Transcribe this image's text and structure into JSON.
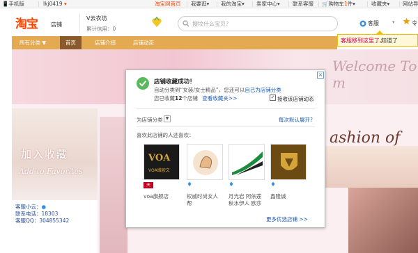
{
  "topnav": {
    "mobile": "手机版",
    "user": "lkj0419",
    "home": "淘宝网首页",
    "my_taobao": "我要逛",
    "my_taobao2": "我的淘宝",
    "seller": "卖家中心",
    "contact": "联系客服",
    "cart": "购物车",
    "cart_count": "1",
    "cart_unit": "件",
    "favorites": "收藏夹",
    "sitenav": "网站导"
  },
  "header": {
    "logo": "淘宝",
    "logo_sub": "店铺",
    "shop_name": "V云衣坊",
    "credit": "累计信用：0",
    "search_placeholder": "搜坟什么宝贝?",
    "kefu": "客服",
    "chat": "令"
  },
  "tip": {
    "text": "客服移到这里了。",
    "ok": "知道了"
  },
  "shopnav": {
    "items": [
      "所有分类 ▼",
      "首页",
      "店铺介绍",
      "店铺动态"
    ]
  },
  "banner": {
    "welcome": "Welcome To m"
  },
  "left": {
    "fav_title": "加入收藏",
    "fav_sub": "Add to Favorites",
    "kefu_label": "客服小云：",
    "phone_label": "联系电话：18303",
    "qq_label": "客服QQ：304855342"
  },
  "bg": {
    "fashion": "ashion of"
  },
  "dialog": {
    "title": "店铺收藏成功！",
    "line1_pre": "自动分类到“女装/女士精品”，您还可以",
    "line1_link": "自己为店铺分类",
    "line2_pre": "您已收藏",
    "line2_count": "12",
    "line2_mid": "个店铺",
    "line2_link": "查看收藏夹>>",
    "checkbox_label": "接收该店铺动态",
    "category_label": "为店铺分类",
    "auto_open": "每次默认展开?",
    "also_label": "喜欢此店铺的人还喜欢：",
    "shops": [
      {
        "name": "voa旗舰店",
        "badge": "天猫"
      },
      {
        "name": "权威时尚女人",
        "name2": "帮",
        "badge": "钻"
      },
      {
        "name": "月光岩 阿依莲",
        "name2": "秋水伊人 欧莎",
        "badge": "钻"
      },
      {
        "name": "鑫隆诚",
        "badge": "钻"
      }
    ],
    "more": "更多优选店铺 >>"
  }
}
